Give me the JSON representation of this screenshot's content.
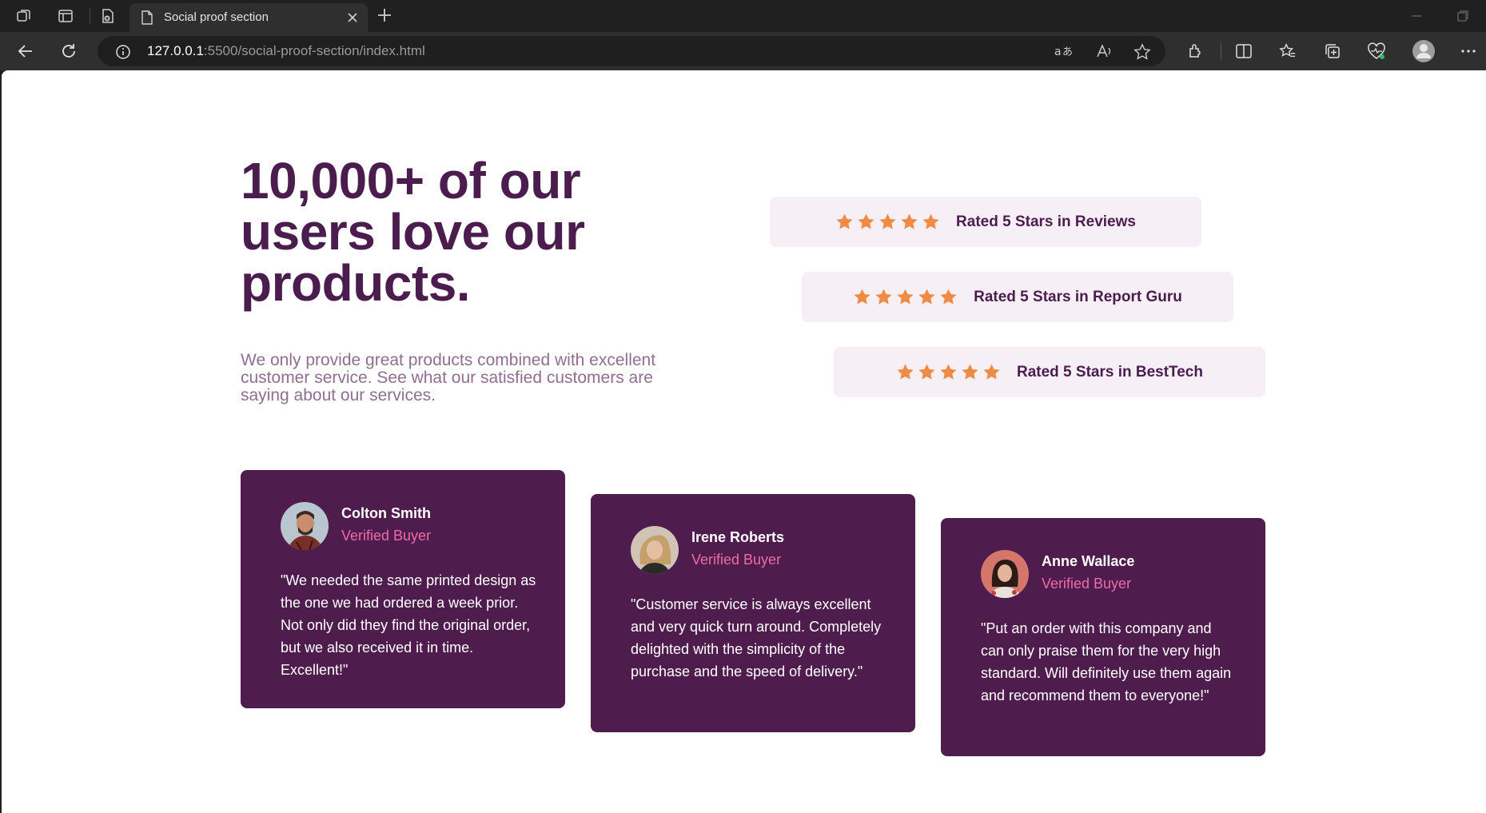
{
  "browser": {
    "tab_title": "Social proof section",
    "url_host": "127.0.0.1",
    "url_rest": ":5500/social-proof-section/index.html"
  },
  "page": {
    "headline": "10,000+ of our users love our products.",
    "intro": "We only provide great products combined with excellent customer service. See what our satisfied customers are saying about our services.",
    "ratings": [
      {
        "stars": 5,
        "label": "Rated 5 Stars in Reviews"
      },
      {
        "stars": 5,
        "label": "Rated 5 Stars in Report Guru"
      },
      {
        "stars": 5,
        "label": "Rated 5 Stars in BestTech"
      }
    ],
    "testimonials": [
      {
        "name": "Colton Smith",
        "role": "Verified Buyer",
        "quote": "\"We needed the same printed design as the one we had ordered a week prior. Not only did they find the original order, but we also received it in time. Excellent!\""
      },
      {
        "name": "Irene Roberts",
        "role": "Verified Buyer",
        "quote": "\"Customer service is always excellent and very quick turn around. Completely delighted with the simplicity of the purchase and the speed of delivery.\""
      },
      {
        "name": "Anne Wallace",
        "role": "Verified Buyer",
        "quote": "\"Put an order with this company and can only praise them for the very high standard. Will definitely use them again and recommend them to everyone!\""
      }
    ]
  },
  "colors": {
    "headline": "#4a1d4e",
    "card_bg": "#4f1d4d",
    "rating_bg": "#f6eff6",
    "star": "#ee8b45",
    "accent_pink": "#ee6ba6"
  }
}
